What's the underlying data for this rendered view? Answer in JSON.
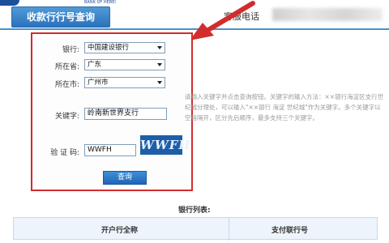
{
  "header": {
    "bank_name_en": "BANK OF HEBEI",
    "tab_title": "收款行行号查询",
    "service_phone_label": "客服电话"
  },
  "form": {
    "bank_label": "银行:",
    "bank_value": "中国建设银行",
    "province_label": "所在省:",
    "province_value": "广东",
    "city_label": "所在市:",
    "city_value": "广州市",
    "keyword_label": "关键字:",
    "keyword_value": "岭南新世界支行",
    "captcha_label": "验 证 码:",
    "captcha_value": "WWFH",
    "captcha_image_text": "WWFH",
    "query_button": "查询"
  },
  "hint": "请输入关键字并点击查询按钮。关键字的输入方法：××银行海淀区支行世纪城分理处，可以输入\"××银行 海淀 世纪城\"作为关键字。多个关键字以空格隔开，区分先后顺序，最多支持三个关键字。",
  "bank_list": {
    "title": "银行列表:",
    "columns": [
      "开户行全称",
      "支付联行号"
    ]
  },
  "colors": {
    "highlight_border": "#d22c2c",
    "accent_blue": "#2c72bb"
  }
}
